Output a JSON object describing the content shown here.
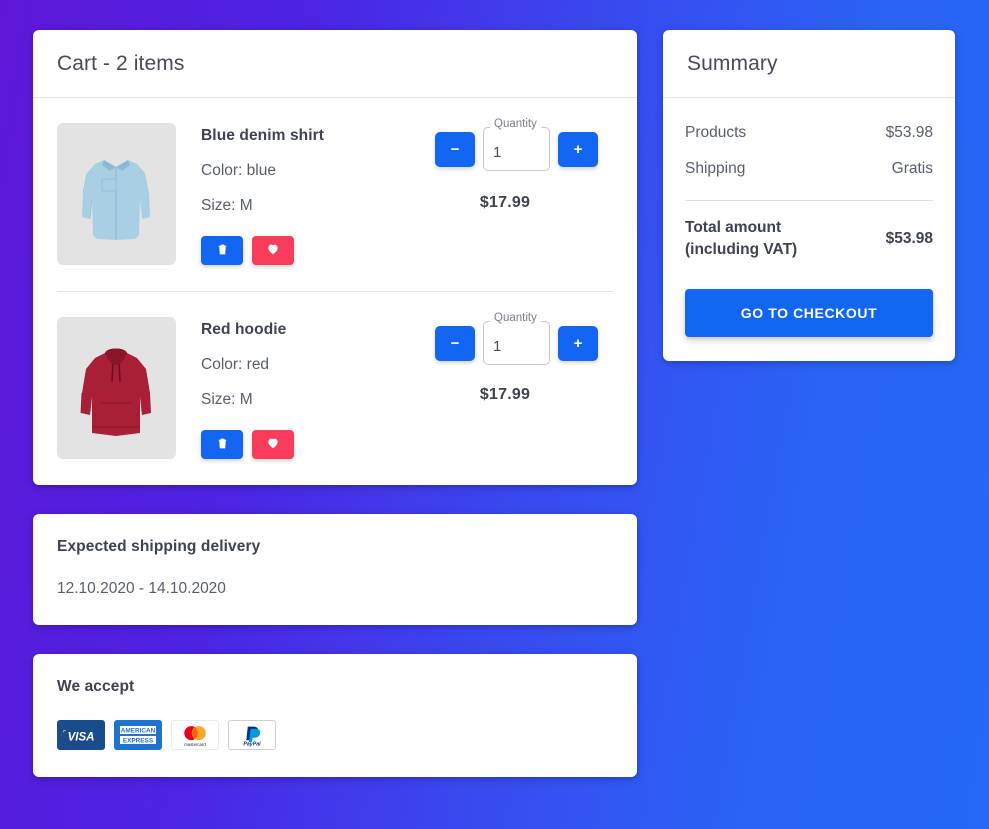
{
  "theme": {
    "bg_gradient_from": "#5e17d8",
    "bg_gradient_to": "#2468f5",
    "accent_blue": "#1266f1",
    "accent_pink": "#f93c5c"
  },
  "cart": {
    "title": "Cart - 2 items",
    "items": [
      {
        "name": "Blue denim shirt",
        "color_line": "Color: blue",
        "size_line": "Size: M",
        "price": "$17.99",
        "quantity": "1",
        "quantity_label": "Quantity",
        "decrease_label": "−",
        "increase_label": "+",
        "image_alt": "blue-denim-shirt",
        "garment_color": "#a9cfe4",
        "garment_shade": "#93bfd8"
      },
      {
        "name": "Red hoodie",
        "color_line": "Color: red",
        "size_line": "Size: M",
        "price": "$17.99",
        "quantity": "1",
        "quantity_label": "Quantity",
        "decrease_label": "−",
        "increase_label": "+",
        "image_alt": "red-hoodie",
        "garment_color": "#a81f36",
        "garment_shade": "#8c1529"
      }
    ]
  },
  "shipping": {
    "title": "Expected shipping delivery",
    "dates": "12.10.2020 - 14.10.2020"
  },
  "payments": {
    "title": "We accept",
    "methods": [
      {
        "name": "Visa",
        "icon": "visa-icon"
      },
      {
        "name": "American Express",
        "icon": "amex-icon"
      },
      {
        "name": "Mastercard",
        "icon": "mastercard-icon"
      },
      {
        "name": "PayPal",
        "icon": "paypal-icon"
      }
    ]
  },
  "summary": {
    "title": "Summary",
    "products_label": "Products",
    "products_value": "$53.98",
    "shipping_label": "Shipping",
    "shipping_value": "Gratis",
    "total_label_line1": "Total amount",
    "total_label_line2": "(including VAT)",
    "total_value": "$53.98",
    "checkout_label": "GO TO CHECKOUT"
  }
}
